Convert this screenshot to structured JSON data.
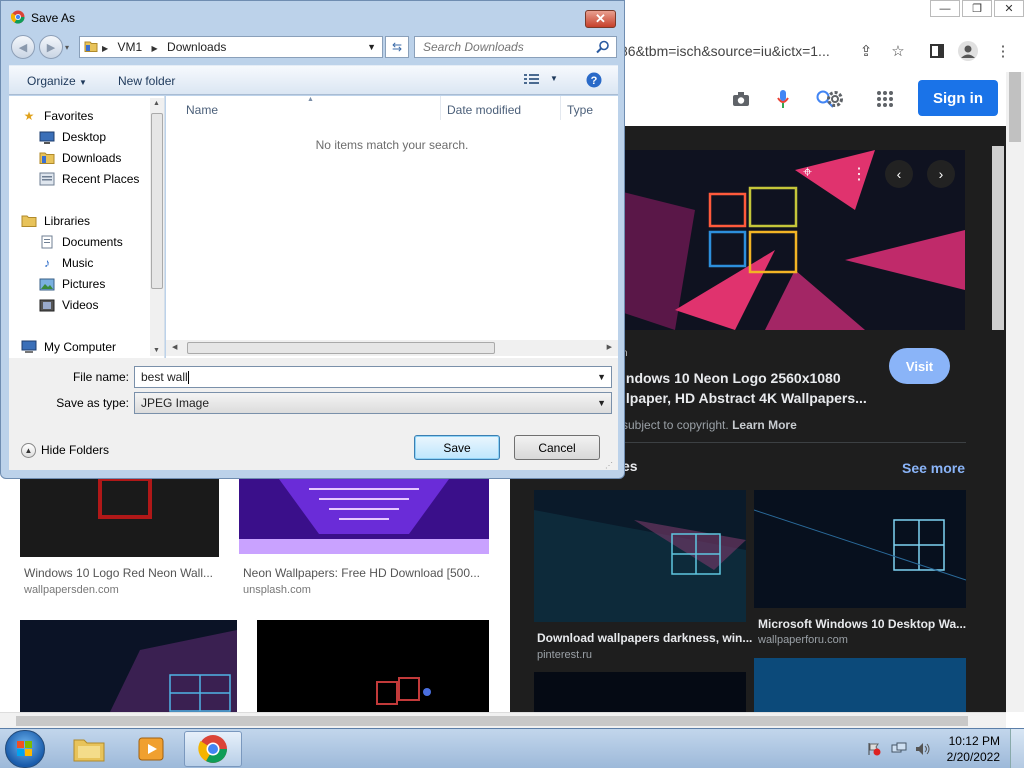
{
  "browser": {
    "url_fragment": "86&tbm=isch&source=iu&ictx=1...",
    "signin_label": "Sign in",
    "results": [
      {
        "title": "Windows 10 Logo Red Neon Wall...",
        "source": "wallpapersden.com"
      },
      {
        "title": "Neon Wallpapers: Free HD Download [500...",
        "source": "unsplash.com"
      }
    ],
    "panel": {
      "source_fragment": "n",
      "title_line1": "indows 10 Neon Logo 2560x1080",
      "title_line2": "llpaper, HD Abstract 4K Wallpapers...",
      "visit_label": "Visit",
      "copyright_text": "subject to copyright.",
      "learn_more": "Learn More",
      "related_fragment": "es",
      "see_more": "See more",
      "related": [
        {
          "title": "Download wallpapers darkness, win...",
          "source": "pinterest.ru"
        },
        {
          "title": "Microsoft Windows 10 Desktop Wa...",
          "source": "wallpaperforu.com"
        }
      ]
    }
  },
  "dialog": {
    "title": "Save As",
    "close_glyph": "✕",
    "breadcrumb": [
      "VM1",
      "Downloads"
    ],
    "search_placeholder": "Search Downloads",
    "toolbar": {
      "organize": "Organize",
      "new_folder": "New folder"
    },
    "nav": {
      "favorites": "Favorites",
      "desktop": "Desktop",
      "downloads": "Downloads",
      "recent_places": "Recent Places",
      "libraries": "Libraries",
      "documents": "Documents",
      "music": "Music",
      "pictures": "Pictures",
      "videos": "Videos",
      "my_computer": "My Computer"
    },
    "columns": {
      "name": "Name",
      "date_modified": "Date modified",
      "type": "Type"
    },
    "empty_message": "No items match your search.",
    "file_name_label": "File name:",
    "file_name_value": "best wall",
    "save_type_label": "Save as type:",
    "save_type_value": "JPEG Image",
    "hide_folders": "Hide Folders",
    "save_label": "Save",
    "cancel_label": "Cancel"
  },
  "taskbar": {
    "time": "10:12 PM",
    "date": "2/20/2022"
  }
}
